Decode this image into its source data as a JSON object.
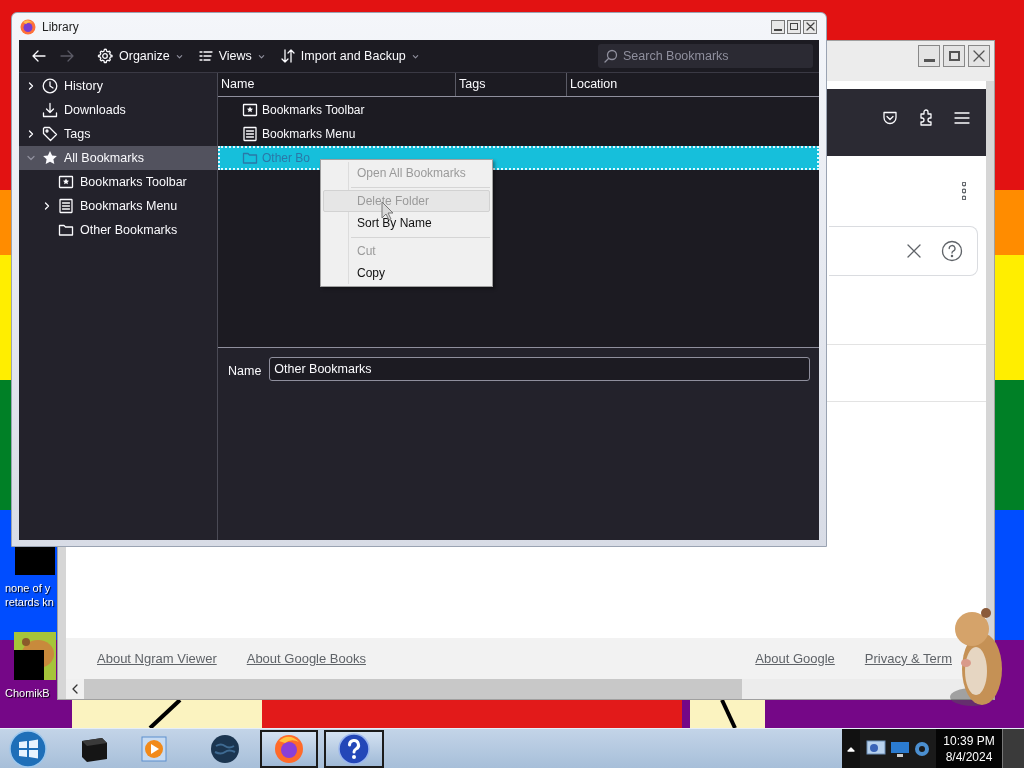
{
  "desktop_icons": [
    {
      "label": [
        "none of y",
        "retards kn"
      ]
    },
    {
      "label": [
        "ChomikB"
      ]
    }
  ],
  "browser": {
    "footer_links": [
      "About Ngram Viewer",
      "About Google Books",
      "About Google",
      "Privacy & Term"
    ]
  },
  "library": {
    "title": "Library",
    "toolbar": [
      {
        "kind": "back",
        "disabled": false
      },
      {
        "kind": "forward",
        "disabled": true
      },
      {
        "kind": "gear",
        "label": "Organize"
      },
      {
        "kind": "list",
        "label": "Views"
      },
      {
        "kind": "sort",
        "label": "Import and Backup"
      }
    ],
    "search": {
      "placeholder": "Search Bookmarks"
    },
    "sidebar": {
      "items": [
        {
          "kind": "history",
          "label": "History",
          "expanded": false,
          "selected": false
        },
        {
          "kind": "downloads",
          "label": "Downloads",
          "selected": false
        },
        {
          "kind": "tags",
          "label": "Tags",
          "expanded": false,
          "selected": false
        },
        {
          "kind": "star",
          "label": "All Bookmarks",
          "expanded": true,
          "selected": true,
          "children": [
            {
              "kind": "toolbar",
              "label": "Bookmarks Toolbar",
              "selected": false
            },
            {
              "kind": "menu",
              "label": "Bookmarks Menu",
              "expanded": false,
              "selected": false
            },
            {
              "kind": "folder",
              "label": "Other Bookmarks",
              "selected": false
            }
          ]
        }
      ]
    },
    "columns": [
      "Name",
      "Tags",
      "Location"
    ],
    "rows": [
      {
        "kind": "toolbar",
        "name": "Bookmarks Toolbar",
        "selected": false
      },
      {
        "kind": "menu",
        "name": "Bookmarks Menu",
        "selected": false
      },
      {
        "kind": "folder",
        "name": "Other Bo",
        "selected": true
      }
    ],
    "details": {
      "label": "Name",
      "value": "Other Bookmarks"
    }
  },
  "context_menu": {
    "items": [
      {
        "kind": "item",
        "label": "Open All Bookmarks",
        "disabled": true,
        "hovered": false
      },
      {
        "kind": "separator"
      },
      {
        "kind": "item",
        "label": "Delete Folder",
        "disabled": true,
        "hovered": true
      },
      {
        "kind": "item",
        "label": "Sort By Name",
        "disabled": false,
        "hovered": false
      },
      {
        "kind": "separator"
      },
      {
        "kind": "item",
        "label": "Cut",
        "disabled": true,
        "hovered": false
      },
      {
        "kind": "item",
        "label": "Copy",
        "disabled": false,
        "hovered": false
      }
    ]
  },
  "taskbar": {
    "apps": [
      {
        "kind": "box",
        "active": false
      },
      {
        "kind": "media",
        "active": false
      },
      {
        "kind": "globe",
        "active": false
      },
      {
        "kind": "firefox",
        "active": true
      },
      {
        "kind": "help",
        "active": true
      }
    ],
    "clock": {
      "time": "10:39 PM",
      "date": "8/4/2024"
    }
  }
}
